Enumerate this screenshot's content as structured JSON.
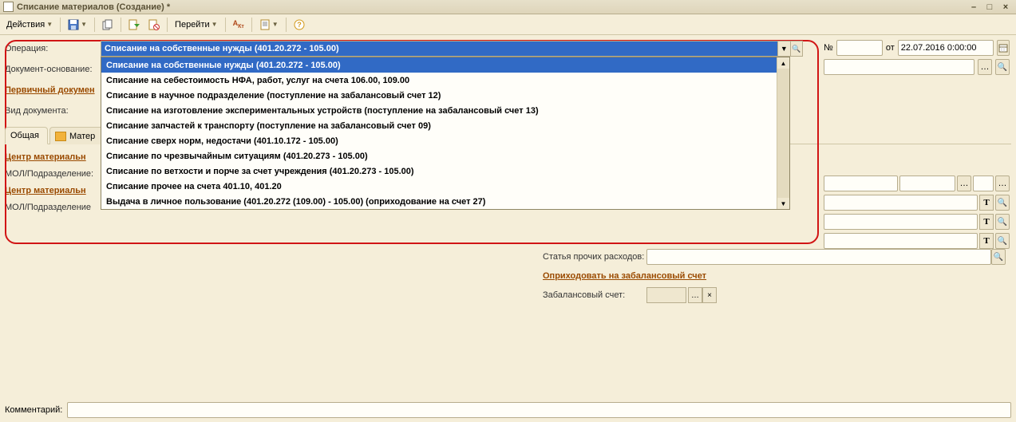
{
  "window": {
    "title": "Списание материалов (Создание) *"
  },
  "toolbar": {
    "actions": "Действия",
    "goto": "Перейти"
  },
  "form": {
    "operation": {
      "label": "Операция:",
      "value": "Списание на собственные нужды (401.20.272 - 105.00)"
    },
    "doc_basis": {
      "label": "Документ-основание:"
    },
    "prim_doc": {
      "label": "Первичный докумен"
    },
    "doc_kind": {
      "label": "Вид документа:"
    },
    "number_lbl": "№",
    "from_lbl": "от",
    "date": "22.07.2016 0:00:00"
  },
  "dropdown_items": [
    "Списание на собственные нужды (401.20.272 - 105.00)",
    "Списание на себестоимость НФА, работ, услуг на счета 106.00, 109.00",
    "Списание в научное подразделение (поступление на забалансовый счет 12)",
    "Списание на изготовление экспериментальных устройств (поступление на забалансовый счет 13)",
    "Списание запчастей к транспорту (поступление на забалансовый счет 09)",
    "Списание сверх норм, недостачи (401.10.172 - 105.00)",
    "Списание по чрезвычайным ситуациям (401.20.273 - 105.00)",
    "Списание по ветхости и порче за счет учреждения (401.20.273 - 105.00)",
    "Списание прочее на счета 401.10, 401.20",
    "Выдача в личное пользование (401.20.272 (109.00) - 105.00) (оприходование на счет 27)"
  ],
  "tabs": {
    "general": "Общая",
    "materials": "Матер"
  },
  "pane": {
    "center1": "Центр материальн",
    "mol1": "МОЛ/Подразделение:",
    "center2": "Центр материальн",
    "mol2": "МОЛ/Подразделение"
  },
  "side": {
    "other_expenses": "Статья прочих расходов:",
    "to_offbalance": "Оприходовать на забалансовый счет",
    "offbalance_account": "Забалансовый счет:"
  },
  "comment": {
    "label": "Комментарий:"
  }
}
